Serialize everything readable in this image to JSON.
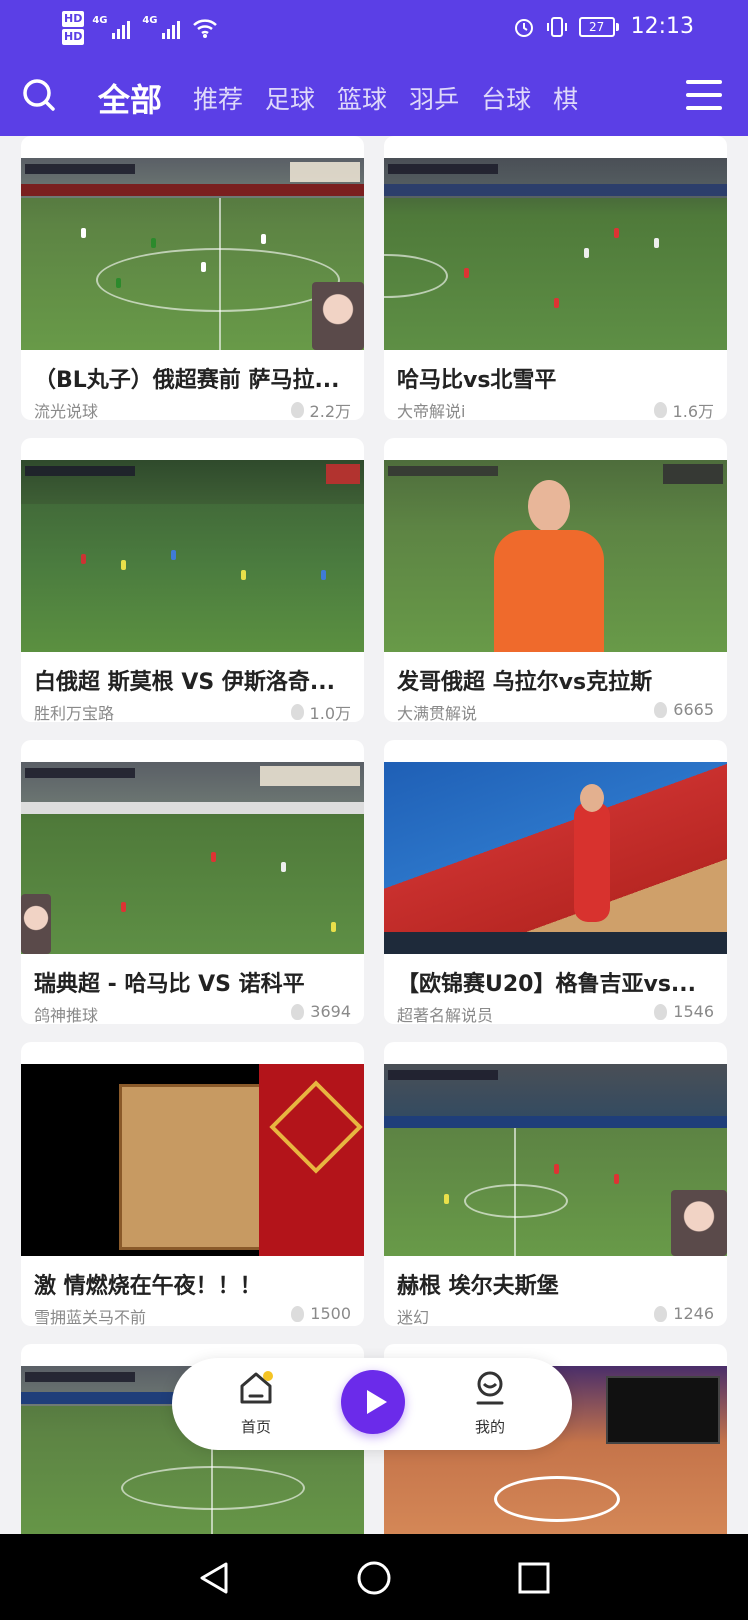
{
  "status_bar": {
    "hd1": "HD",
    "hd2": "HD",
    "net1": "4G",
    "net2": "4G",
    "battery": "27",
    "time": "12:13"
  },
  "nav": {
    "tabs": [
      {
        "label": "全部"
      },
      {
        "label": "推荐"
      },
      {
        "label": "足球"
      },
      {
        "label": "篮球"
      },
      {
        "label": "羽乒"
      },
      {
        "label": "台球"
      },
      {
        "label": "棋"
      }
    ]
  },
  "cards": [
    {
      "title": "（BL丸子）俄超赛前 萨马拉...",
      "author": "流光说球",
      "count": "2.2万"
    },
    {
      "title": "哈马比vs北雪平",
      "author": "大帝解说i",
      "count": "1.6万"
    },
    {
      "title": "白俄超 斯莫根 VS 伊斯洛奇...",
      "author": "胜利万宝路",
      "count": "1.0万"
    },
    {
      "title": "发哥俄超 乌拉尔vs克拉斯",
      "author": "大满贯解说",
      "count": "6665"
    },
    {
      "title": "瑞典超 - 哈马比 VS 诺科平",
      "author": "鸽神推球",
      "count": "3694"
    },
    {
      "title": "【欧锦赛U20】格鲁吉亚vs...",
      "author": "超著名解说员",
      "count": "1546"
    },
    {
      "title": "激 情燃烧在午夜！！！",
      "author": "雪拥蓝关马不前",
      "count": "1500"
    },
    {
      "title": "赫根  埃尔夫斯堡",
      "author": "迷幻",
      "count": "1246"
    }
  ],
  "bottom_nav": {
    "home": "首页",
    "mine": "我的"
  },
  "accent": "#5b3fe6"
}
